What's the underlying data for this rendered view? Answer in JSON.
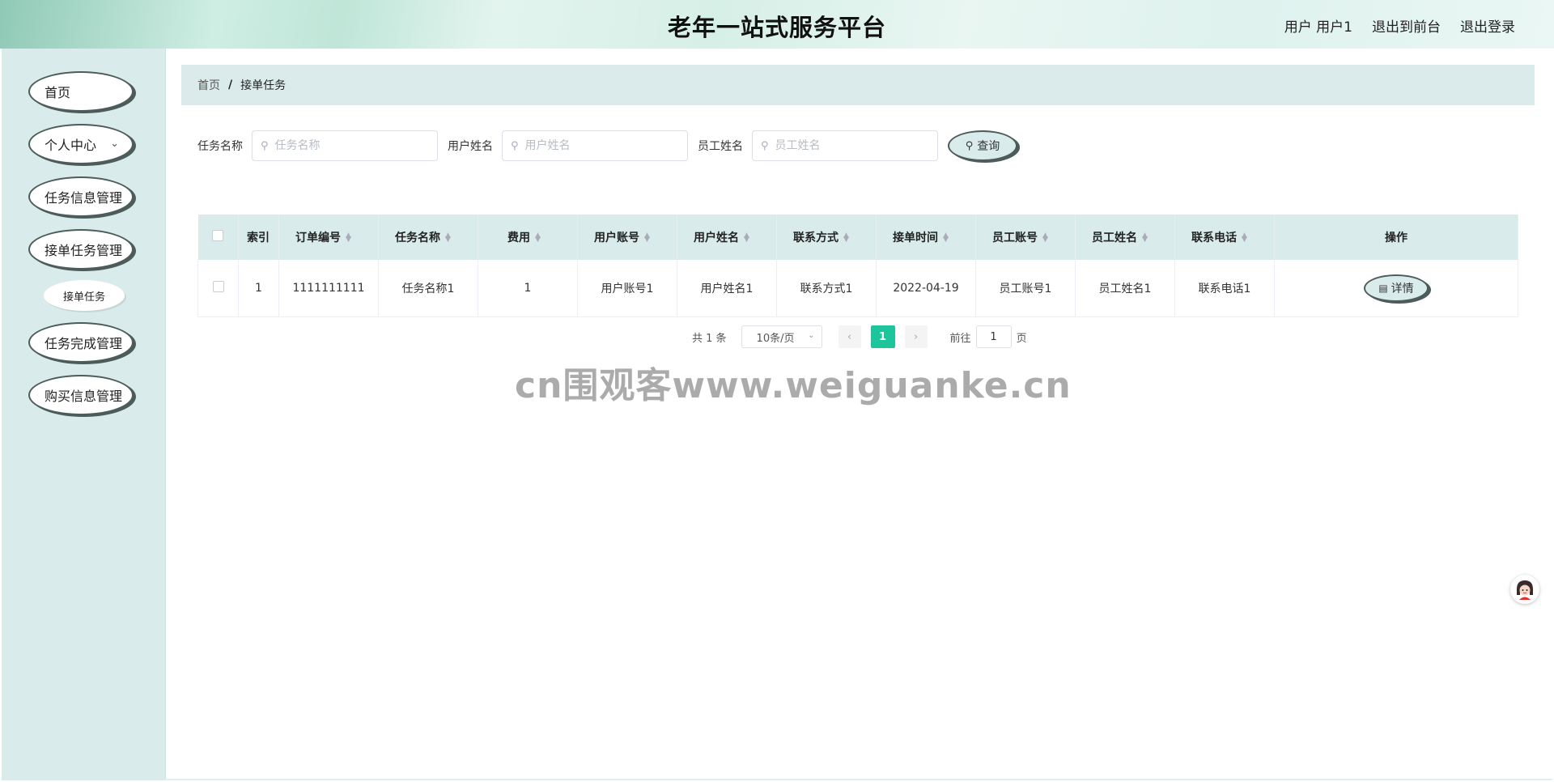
{
  "header": {
    "title": "老年一站式服务平台",
    "user": "用户 用户1",
    "back_to_front": "退出到前台",
    "logout": "退出登录"
  },
  "sidebar": {
    "items": [
      {
        "label": "首页"
      },
      {
        "label": "个人中心"
      },
      {
        "label": "任务信息管理"
      },
      {
        "label": "接单任务管理"
      },
      {
        "label": "任务完成管理"
      },
      {
        "label": "购买信息管理"
      }
    ],
    "submenu": {
      "label": "接单任务"
    }
  },
  "breadcrumb": {
    "home": "首页",
    "separator": "/",
    "current": "接单任务"
  },
  "search": {
    "task_name_label": "任务名称",
    "task_name_placeholder": "任务名称",
    "user_name_label": "用户姓名",
    "user_name_placeholder": "用户姓名",
    "staff_name_label": "员工姓名",
    "staff_name_placeholder": "员工姓名",
    "query_label": "查询"
  },
  "table": {
    "columns": [
      "索引",
      "订单编号",
      "任务名称",
      "费用",
      "用户账号",
      "用户姓名",
      "联系方式",
      "接单时间",
      "员工账号",
      "员工姓名",
      "联系电话",
      "操作"
    ],
    "rows": [
      {
        "index": "1",
        "order_no": "1111111111",
        "task_name": "任务名称1",
        "fee": "1",
        "user_account": "用户账号1",
        "user_name": "用户姓名1",
        "contact": "联系方式1",
        "accept_time": "2022-04-19",
        "staff_account": "员工账号1",
        "staff_name": "员工姓名1",
        "phone": "联系电话1",
        "action": "详情"
      }
    ]
  },
  "pagination": {
    "total": "共 1 条",
    "page_size": "10条/页",
    "current_page": "1",
    "goto_label": "前往",
    "goto_value": "1",
    "page_suffix": "页"
  },
  "watermark": "cn围观客www.weiguanke.cn",
  "icons": {
    "search": "search-icon",
    "document": "document-icon",
    "chevron": "chevron-down-icon",
    "avatar": "avatar-icon"
  },
  "colors": {
    "accent": "#1ec59c",
    "panel": "#d9ebeb",
    "outline": "#4c5c5a"
  }
}
